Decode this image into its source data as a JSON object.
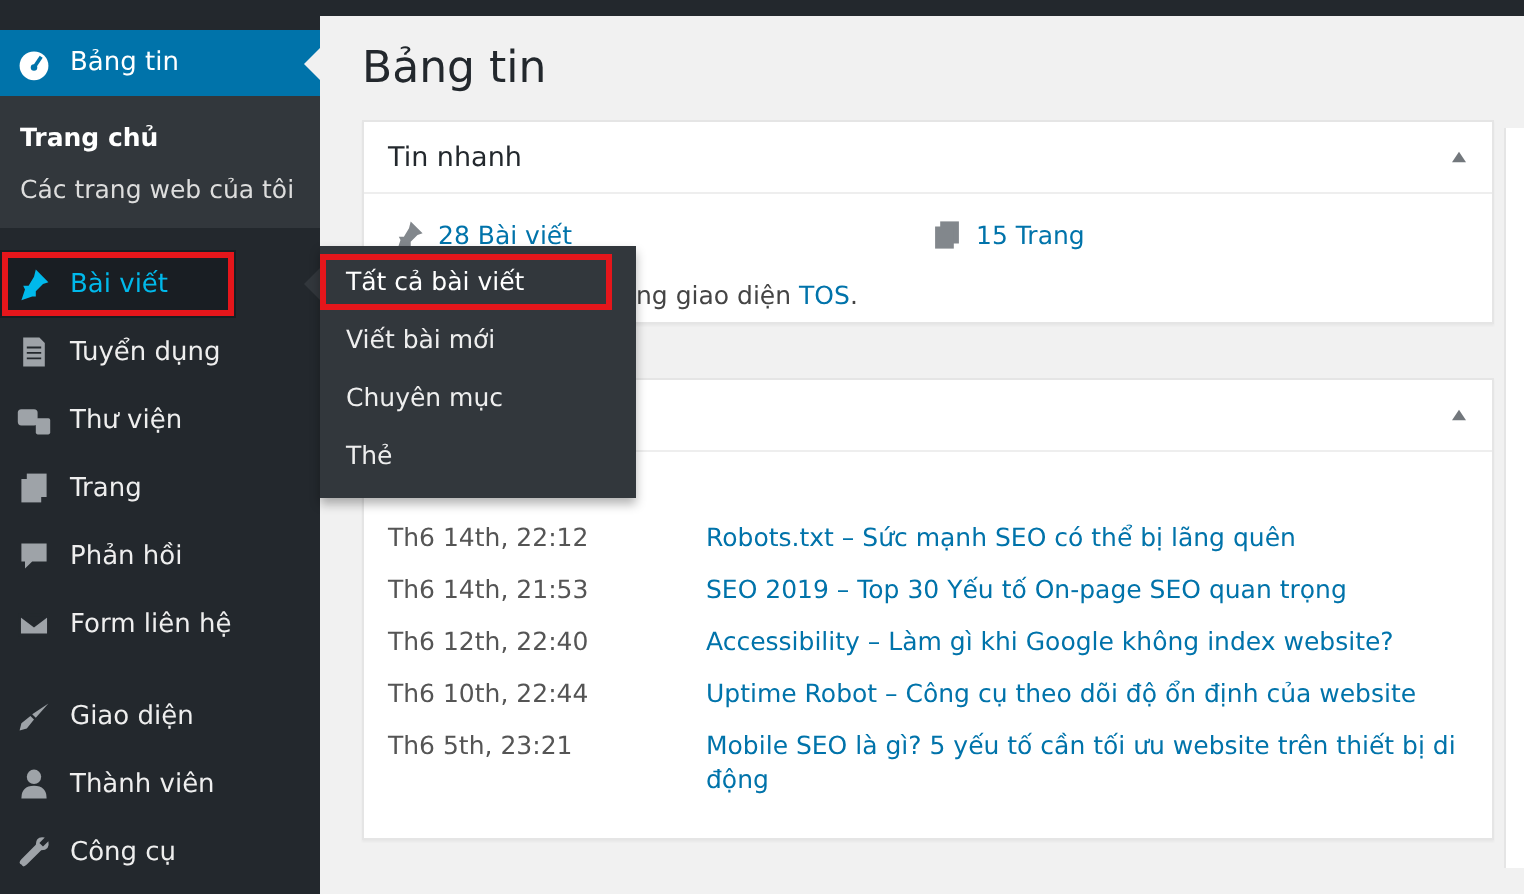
{
  "sidebar": {
    "groups": [
      {
        "items": [
          {
            "label": "Bảng tin",
            "kind": "gauge",
            "current": true,
            "highlighted": false,
            "submenu": [
              "Trang chủ",
              "Các trang web của tôi"
            ]
          },
          {
            "label": "Bài viết",
            "kind": "pin",
            "current": false,
            "hovered": true,
            "highlighted": true,
            "flyout": [
              {
                "label": "Tất cả bài viết",
                "highlighted": true
              },
              {
                "label": "Viết bài mới",
                "highlighted": false
              },
              {
                "label": "Chuyên mục",
                "highlighted": false
              },
              {
                "label": "Thẻ",
                "highlighted": false
              }
            ]
          },
          {
            "label": "Tuyển dụng",
            "kind": "doc",
            "current": false,
            "highlighted": false
          },
          {
            "label": "Thư viện",
            "kind": "media",
            "current": false,
            "highlighted": false
          },
          {
            "label": "Trang",
            "kind": "pages",
            "current": false,
            "highlighted": false
          },
          {
            "label": "Phản hồi",
            "kind": "comment",
            "current": false,
            "highlighted": false
          },
          {
            "label": "Form liên hệ",
            "kind": "mail",
            "current": false,
            "highlighted": false
          }
        ]
      },
      {
        "items": [
          {
            "label": "Giao diện",
            "kind": "brush",
            "current": false,
            "highlighted": false
          },
          {
            "label": "Thành viên",
            "kind": "user",
            "current": false,
            "highlighted": false
          },
          {
            "label": "Công cụ",
            "kind": "wrench",
            "current": false,
            "highlighted": false
          }
        ]
      }
    ]
  },
  "page_title": "Bảng tin",
  "glance": {
    "title": "Tin nhanh",
    "stats": [
      {
        "kind": "pin",
        "label": "28 Bài viết"
      },
      {
        "kind": "pages",
        "label": "15 Trang"
      }
    ],
    "theme_text": "ng giao diện ",
    "theme_link": "TOS",
    "theme_end": "."
  },
  "activity": {
    "rows": [
      {
        "date": "Th6 14th, 22:12",
        "title": "Robots.txt – Sức mạnh SEO có thể bị lãng quên"
      },
      {
        "date": "Th6 14th, 21:53",
        "title": "SEO 2019 – Top 30 Yếu tố On-page SEO quan trọng"
      },
      {
        "date": "Th6 12th, 22:40",
        "title": "Accessibility – Làm gì khi Google không index website?"
      },
      {
        "date": "Th6 10th, 22:44",
        "title": "Uptime Robot – Công cụ theo dõi độ ổn định của website"
      },
      {
        "date": "Th6 5th, 23:21",
        "title": "Mobile SEO là gì? 5 yếu tố cần tối ưu website trên thiết bị di động"
      }
    ]
  }
}
